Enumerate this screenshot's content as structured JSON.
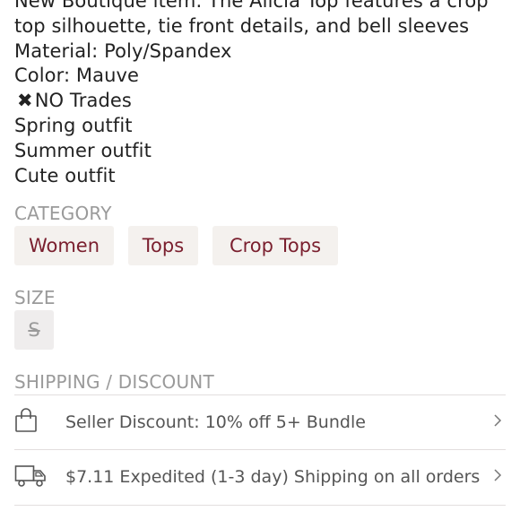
{
  "description": {
    "lines": [
      "New Boutique item. The Alicia Top features a crop",
      "top silhouette, tie front details, and bell sleeves",
      "Material: Poly/Spandex",
      "Color: Mauve",
      "NO Trades",
      "Spring outfit",
      "Summer outfit",
      "Cute outfit"
    ],
    "no_trades_symbol": "✖"
  },
  "category": {
    "label": "CATEGORY",
    "chips": [
      "Women",
      "Tops",
      "Crop Tops"
    ]
  },
  "size": {
    "label": "SIZE",
    "value": "S"
  },
  "shipping": {
    "label": "SHIPPING / DISCOUNT",
    "rows": [
      {
        "icon": "shopping-bag-icon",
        "text": "Seller Discount: 10% off 5+ Bundle"
      },
      {
        "icon": "delivery-truck-icon",
        "text": "$7.11 Expedited (1-3 day) Shipping on all orders"
      }
    ]
  },
  "colors": {
    "chip_text": "#7a1f2e",
    "chip_bg": "#f4f1ee",
    "label": "#9a9a9a",
    "body_text": "#222222"
  }
}
